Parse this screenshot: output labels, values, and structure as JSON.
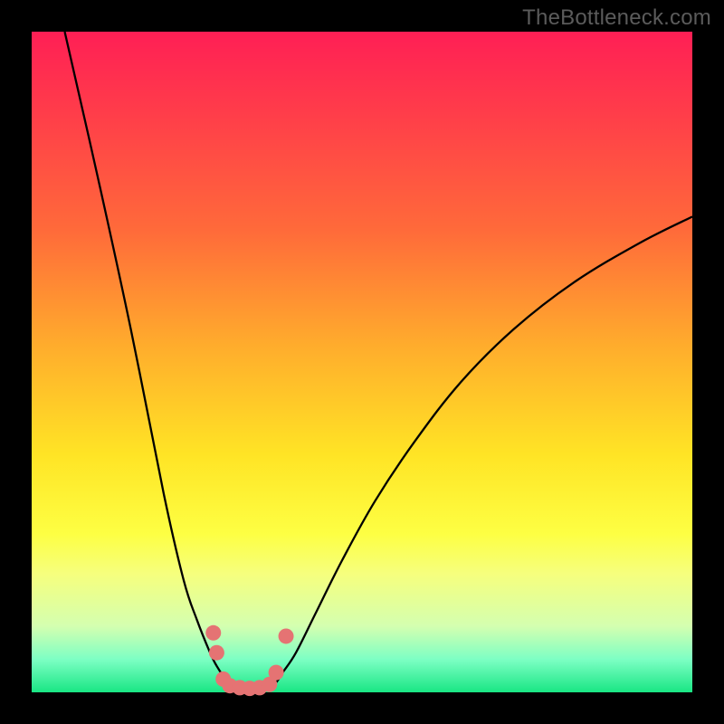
{
  "attribution": "TheBottleneck.com",
  "colors": {
    "curve": "#000000",
    "marker": "#e57373",
    "background_top": "#ff1f55",
    "background_bottom": "#19e684"
  },
  "chart_data": {
    "type": "line",
    "title": "",
    "xlabel": "",
    "ylabel": "",
    "xlim": [
      0,
      100
    ],
    "ylim": [
      0,
      100
    ],
    "grid": false,
    "legend": false,
    "series": [
      {
        "name": "left-branch",
        "x": [
          5,
          10,
          15,
          20,
          23,
          25,
          27,
          28,
          29,
          30,
          31
        ],
        "y": [
          100,
          78,
          55,
          30,
          17,
          11,
          6,
          4,
          2.5,
          1.5,
          1
        ]
      },
      {
        "name": "right-branch",
        "x": [
          36,
          37,
          38,
          40,
          43,
          47,
          52,
          58,
          65,
          73,
          82,
          92,
          100
        ],
        "y": [
          1,
          1.5,
          3,
          6,
          12,
          20,
          29,
          38,
          47,
          55,
          62,
          68,
          72
        ]
      }
    ],
    "markers": {
      "name": "dip-points",
      "points": [
        {
          "x": 27.5,
          "y": 9
        },
        {
          "x": 28,
          "y": 6
        },
        {
          "x": 29,
          "y": 2
        },
        {
          "x": 30,
          "y": 1
        },
        {
          "x": 31.5,
          "y": 0.7
        },
        {
          "x": 33,
          "y": 0.6
        },
        {
          "x": 34.5,
          "y": 0.7
        },
        {
          "x": 36,
          "y": 1.2
        },
        {
          "x": 37,
          "y": 3
        },
        {
          "x": 38.5,
          "y": 8.5
        }
      ]
    },
    "gradient_stops": [
      {
        "pos": 0.0,
        "color": "#ff1f55"
      },
      {
        "pos": 0.3,
        "color": "#ff6a3a"
      },
      {
        "pos": 0.64,
        "color": "#ffe425"
      },
      {
        "pos": 0.82,
        "color": "#f6ff7d"
      },
      {
        "pos": 0.95,
        "color": "#7dffc4"
      },
      {
        "pos": 1.0,
        "color": "#19e684"
      }
    ]
  }
}
